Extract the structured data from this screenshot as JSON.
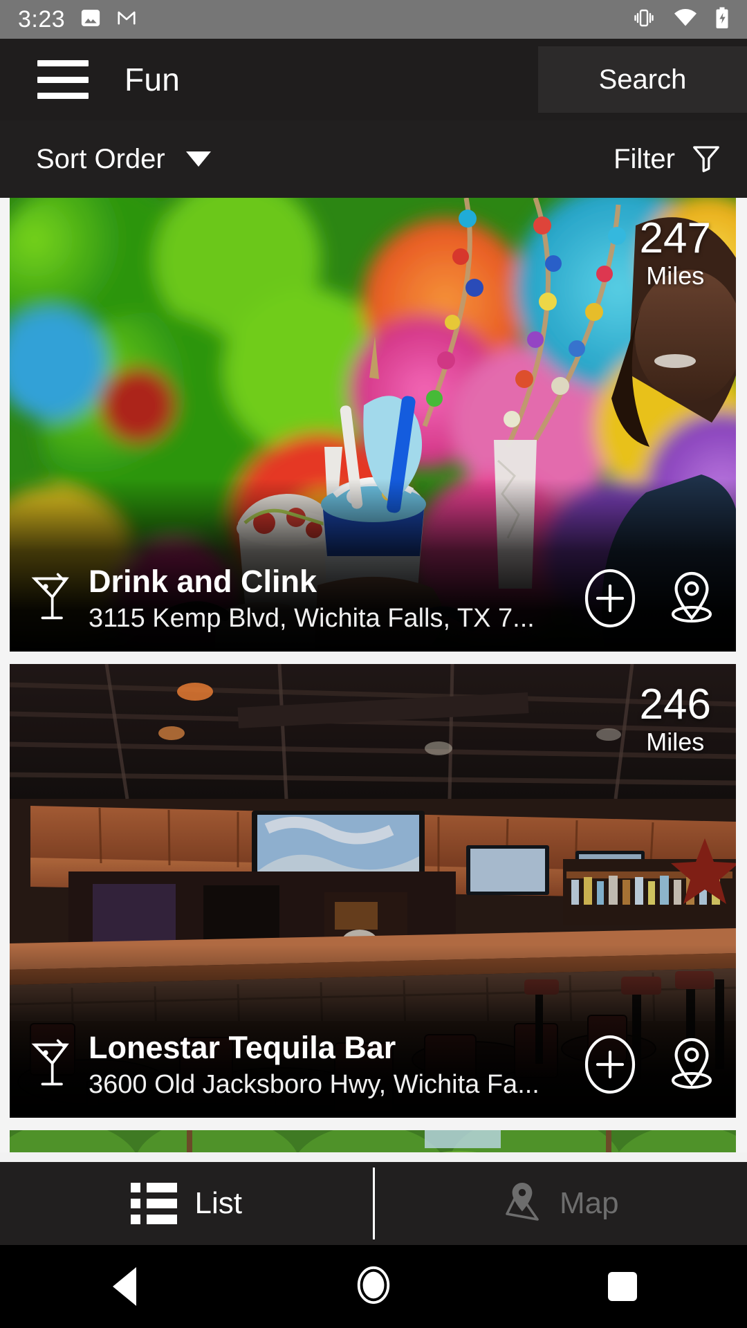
{
  "status_bar": {
    "time": "3:23",
    "left_icons": [
      "photo-icon",
      "gmail-icon"
    ],
    "right_icons": [
      "vibrate-icon",
      "wifi-icon",
      "battery-charging-icon"
    ],
    "background_color": "#767676"
  },
  "app_bar": {
    "menu_icon": "hamburger-menu-icon",
    "title": "Fun",
    "search_label": "Search",
    "background_color": "#1f1d1d"
  },
  "sort_bar": {
    "sort_label": "Sort Order",
    "sort_caret_icon": "chevron-down-icon",
    "filter_label": "Filter",
    "filter_icon": "funnel-icon",
    "background_color": "#211f1f"
  },
  "list": {
    "items": [
      {
        "name": "Drink and Clink",
        "address": "3115 Kemp Blvd, Wichita Falls, TX 7...",
        "distance_value": "247",
        "distance_unit": "Miles",
        "category_icon": "cocktail-glass-icon",
        "add_icon": "plus-circle-icon",
        "map_icon": "map-pin-icon",
        "photo_alt": "colorful-paper-flower-wall-milkshakes"
      },
      {
        "name": "Lonestar Tequila Bar",
        "address": "3600 Old Jacksboro Hwy, Wichita Fa...",
        "distance_value": "246",
        "distance_unit": "Miles",
        "category_icon": "cocktail-glass-icon",
        "add_icon": "plus-circle-icon",
        "map_icon": "map-pin-icon",
        "photo_alt": "wooden-bar-interior-tables-chairs-tvs"
      },
      {
        "photo_alt": "green-hedge-outdoor"
      }
    ]
  },
  "tab_bar": {
    "tabs": [
      {
        "label": "List",
        "icon": "list-icon",
        "active": true
      },
      {
        "label": "Map",
        "icon": "map-pin-icon",
        "active": false
      }
    ],
    "active_color": "#ffffff",
    "inactive_color": "#6d6d6d",
    "background_color": "#211f1f"
  },
  "nav_bar": {
    "back_icon": "back-triangle-icon",
    "home_icon": "home-circle-icon",
    "recents_icon": "recents-square-icon",
    "background_color": "#000000"
  }
}
